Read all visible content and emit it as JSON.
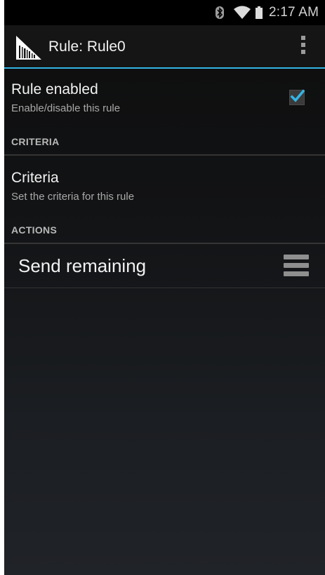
{
  "status_bar": {
    "time": "2:17 AM",
    "icons": [
      "bluetooth-icon",
      "wifi-icon",
      "battery-icon"
    ]
  },
  "action_bar": {
    "title": "Rule: Rule0",
    "logo_icon": "barcode-scanner-icon",
    "overflow_icon": "overflow-menu-icon"
  },
  "preferences": {
    "rule_enabled": {
      "title": "Rule enabled",
      "summary": "Enable/disable this rule",
      "checked": true
    },
    "criteria_category": "CRITERIA",
    "criteria": {
      "title": "Criteria",
      "summary": "Set the criteria for this rule"
    },
    "actions_category": "ACTIONS",
    "actions": [
      {
        "label": "Send remaining",
        "handle_icon": "drag-handle-icon"
      }
    ]
  },
  "colors": {
    "accent": "#33b5e5",
    "background": "#121315",
    "text_primary": "#f2f2f2",
    "text_secondary": "#a8a8a8"
  }
}
